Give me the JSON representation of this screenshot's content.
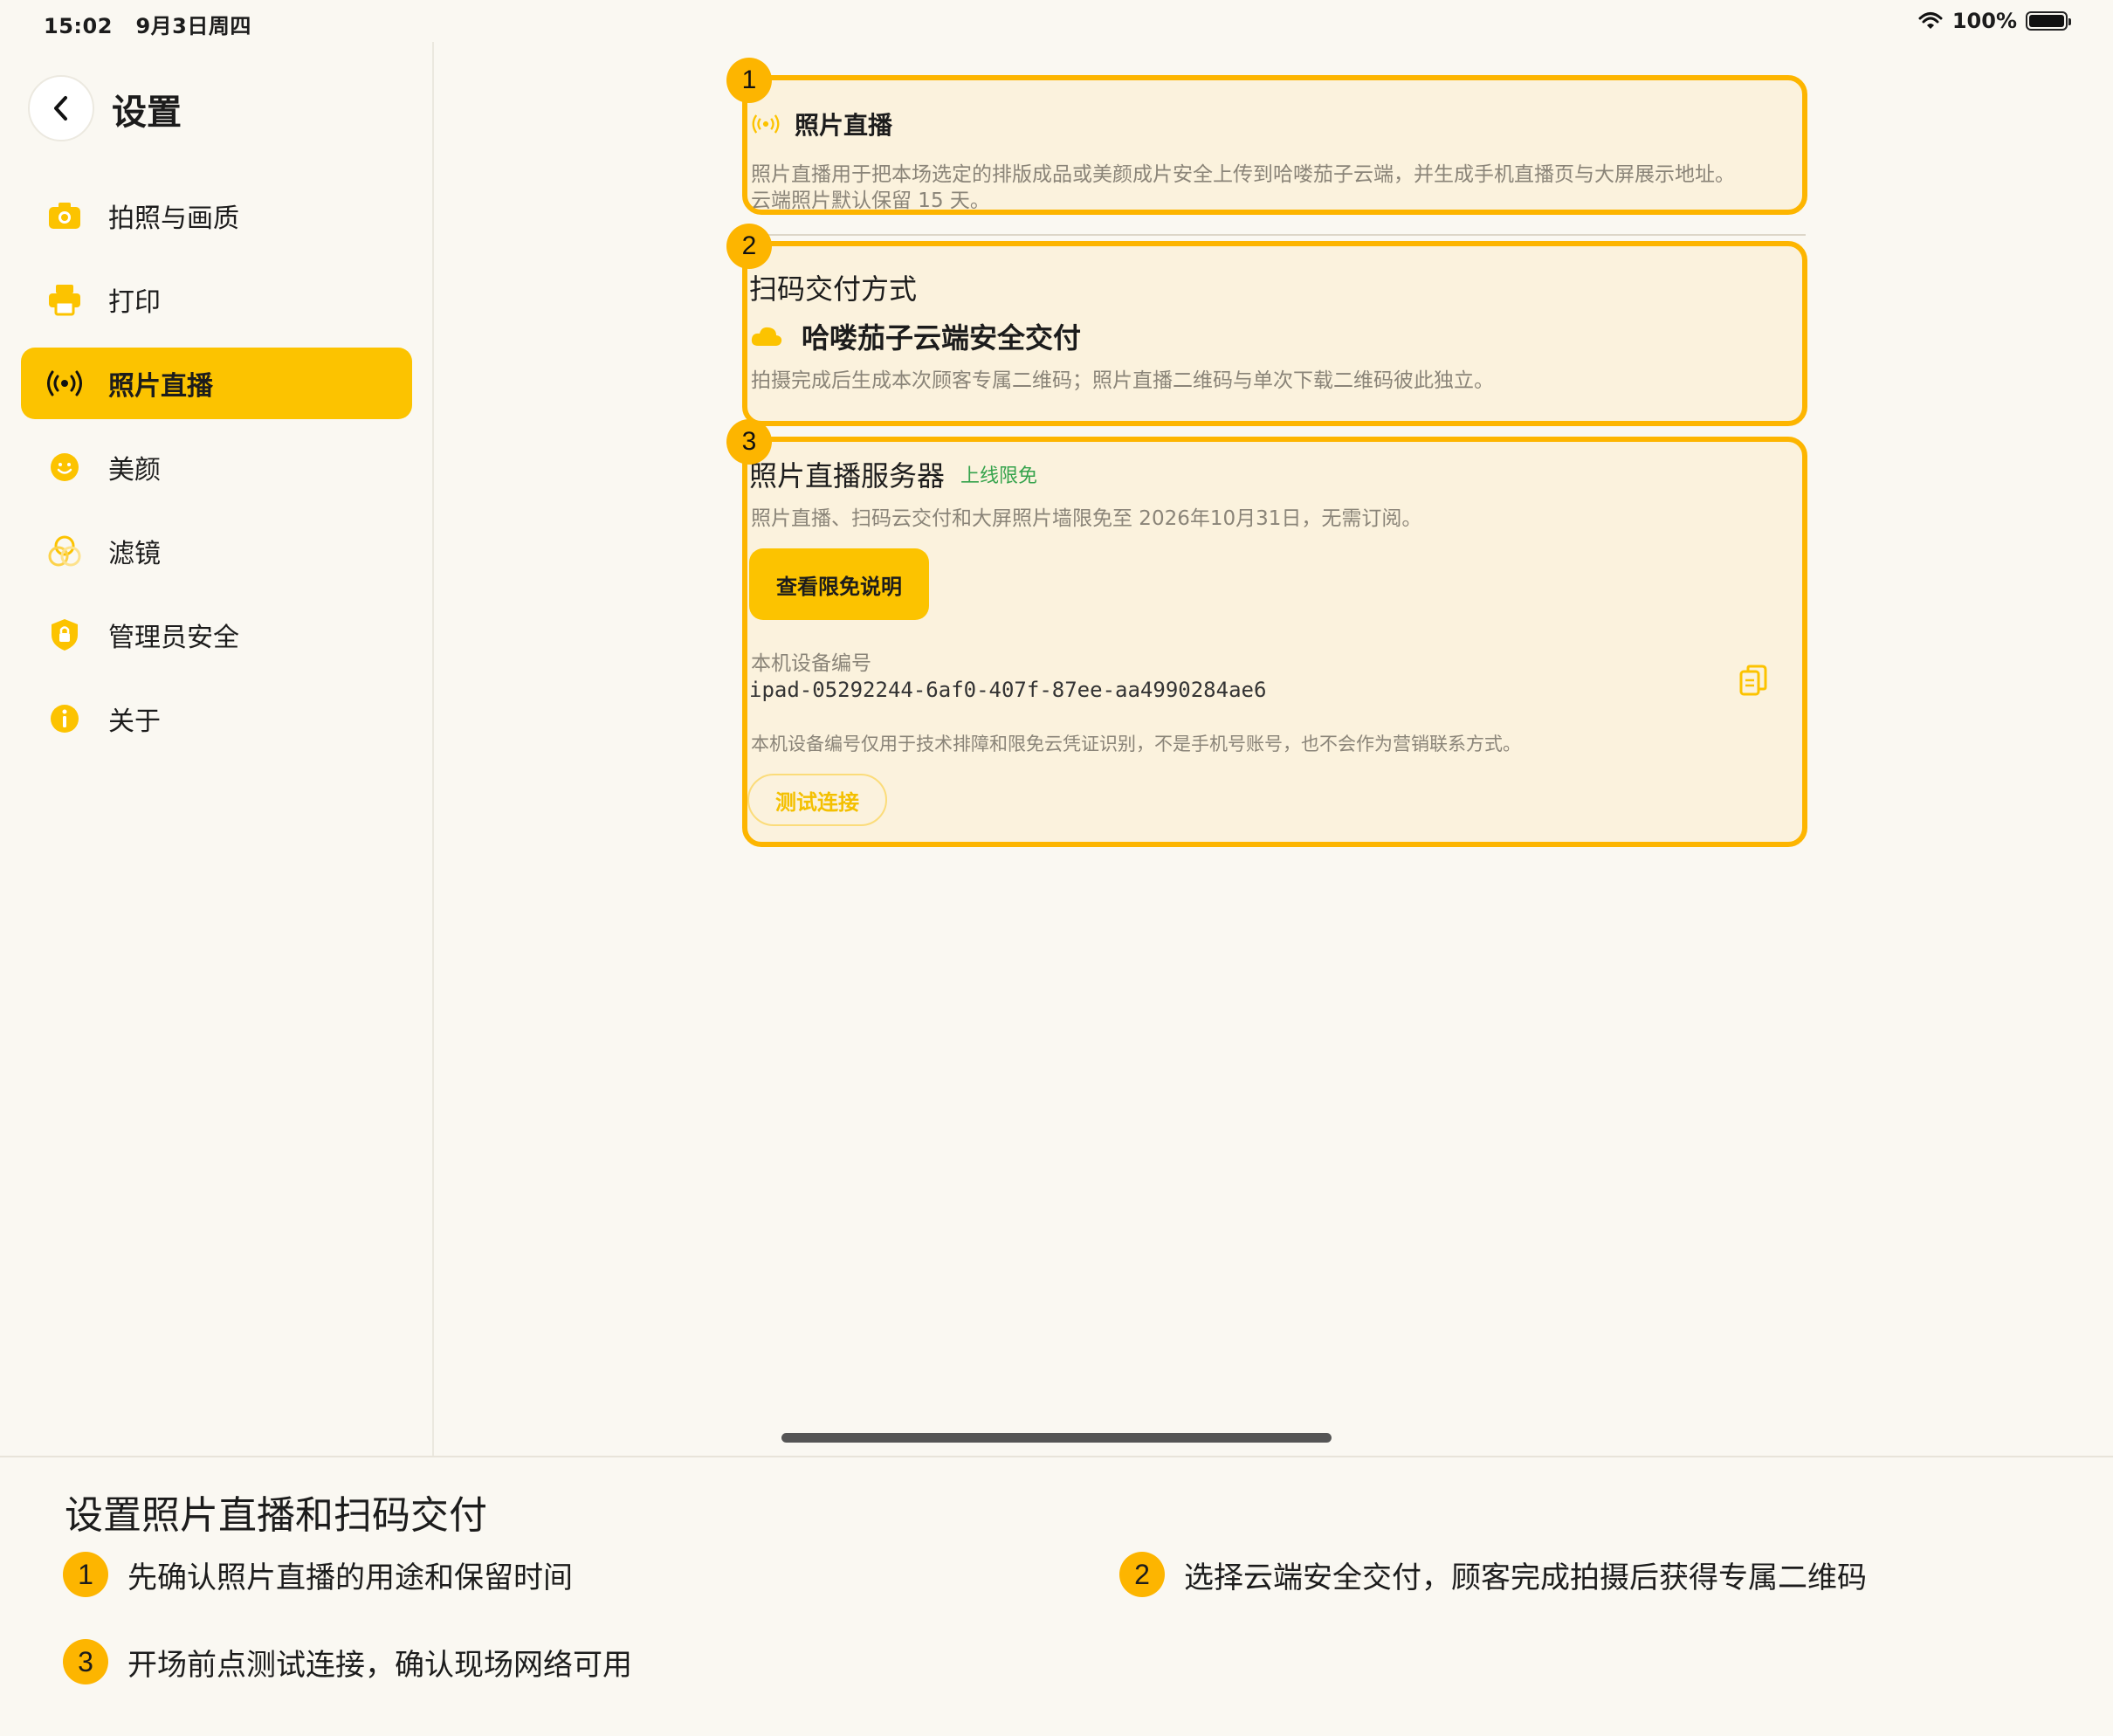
{
  "status": {
    "time": "15:02",
    "date": "9月3日周四",
    "battery": "100%"
  },
  "sidebar": {
    "title": "设置",
    "items": [
      {
        "label": "拍照与画质",
        "icon": "camera-icon"
      },
      {
        "label": "打印",
        "icon": "printer-icon"
      },
      {
        "label": "照片直播",
        "icon": "broadcast-icon",
        "active": true
      },
      {
        "label": "美颜",
        "icon": "smile-icon"
      },
      {
        "label": "滤镜",
        "icon": "filter-icon"
      },
      {
        "label": "管理员安全",
        "icon": "shield-icon"
      },
      {
        "label": "关于",
        "icon": "info-icon"
      }
    ]
  },
  "cards": {
    "live": {
      "badge": "1",
      "title": "照片直播",
      "desc_line1": "照片直播用于把本场选定的排版成品或美颜成片安全上传到哈喽茄子云端，并生成手机直播页与大屏展示地址。",
      "desc_line2": "云端照片默认保留 15 天。"
    },
    "delivery": {
      "badge": "2",
      "title": "扫码交付方式",
      "option": "哈喽茄子云端安全交付",
      "desc": "拍摄完成后生成本次顾客专属二维码；照片直播二维码与单次下载二维码彼此独立。"
    },
    "server": {
      "badge": "3",
      "title": "照片直播服务器",
      "tag": "上线限免",
      "desc": "照片直播、扫码云交付和大屏照片墙限免至 2026年10月31日，无需订阅。",
      "button": "查看限免说明",
      "device_label": "本机设备编号",
      "device_id": "ipad-05292244-6af0-407f-87ee-aa4990284ae6",
      "note": "本机设备编号仅用于技术排障和限免云凭证识别，不是手机号账号，也不会作为营销联系方式。",
      "test_button": "测试连接"
    }
  },
  "instructions": {
    "title": "设置照片直播和扫码交付",
    "steps": [
      {
        "num": "1",
        "text": "先确认照片直播的用途和保留时间"
      },
      {
        "num": "2",
        "text": "选择云端安全交付，顾客完成拍摄后获得专属二维码"
      },
      {
        "num": "3",
        "text": "开场前点测试连接，确认现场网络可用"
      }
    ]
  },
  "colors": {
    "accent": "#fcc300",
    "highlight_border": "#fdb500",
    "card_bg": "#fbf2dd",
    "tag_green": "#35a34c"
  }
}
